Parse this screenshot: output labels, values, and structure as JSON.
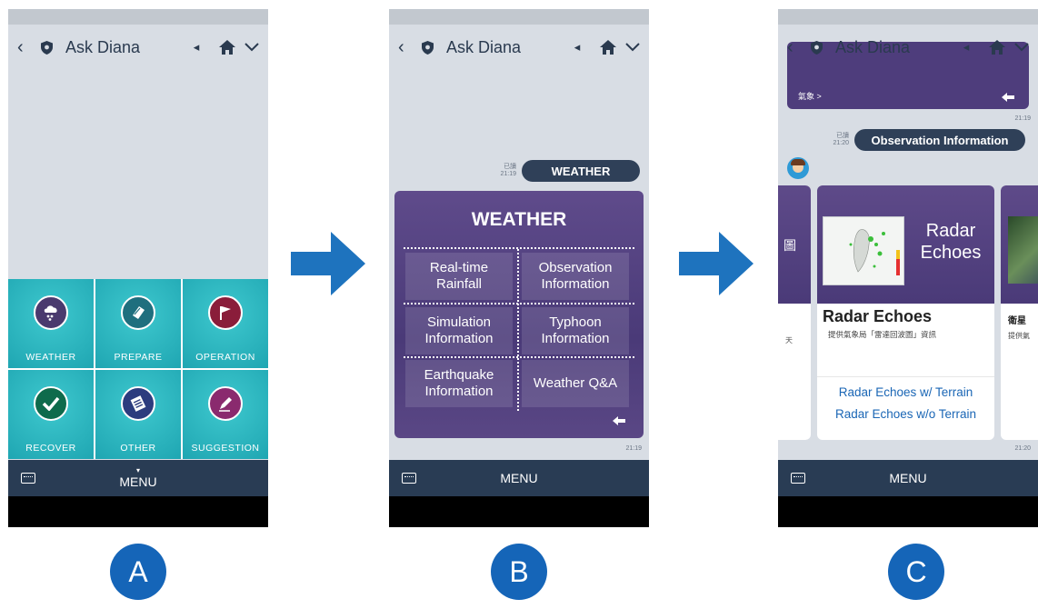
{
  "app": {
    "title": "Ask Diana",
    "menu_label": "MENU"
  },
  "step_letters": [
    "A",
    "B",
    "C"
  ],
  "panelA": {
    "tiles": [
      {
        "label": "WEATHER",
        "icon": "cloud-rain-icon",
        "color": "#4a3a6e"
      },
      {
        "label": "PREPARE",
        "icon": "tape-icon",
        "color": "#1f6f7e"
      },
      {
        "label": "OPERATION",
        "icon": "flag-icon",
        "color": "#8a1d3a"
      },
      {
        "label": "RECOVER",
        "icon": "check-icon",
        "color": "#0e6b4c"
      },
      {
        "label": "OTHER",
        "icon": "document-icon",
        "color": "#2c3c7e"
      },
      {
        "label": "SUGGESTION",
        "icon": "pencil-icon",
        "color": "#8a2a6e"
      }
    ]
  },
  "panelB": {
    "read_label": "已讀",
    "time": "21:19",
    "user_message": "WEATHER",
    "card_title": "WEATHER",
    "items": [
      "Real-time Rainfall",
      "Observation Information",
      "Simulation Information",
      "Typhoon Information",
      "Earthquake Information",
      "Weather Q&A"
    ],
    "card_time": "21:19"
  },
  "panelC": {
    "top_card_caption": "氣象 >",
    "top_time": "21:19",
    "read_label": "已讀",
    "time": "21:20",
    "user_message": "Observation Information",
    "card": {
      "image_title": "Radar Echoes",
      "heading": "Radar Echoes",
      "description": "提供氣象局「雷達回波圖」資訊",
      "links": [
        "Radar Echoes w/ Terrain",
        "Radar Echoes w/o Terrain"
      ]
    },
    "left_card_glyph_top": "圖",
    "left_card_glyph_bottom": "天",
    "right_card_heading": "衛星",
    "right_card_desc": "提供氣",
    "card_time": "21:20"
  }
}
